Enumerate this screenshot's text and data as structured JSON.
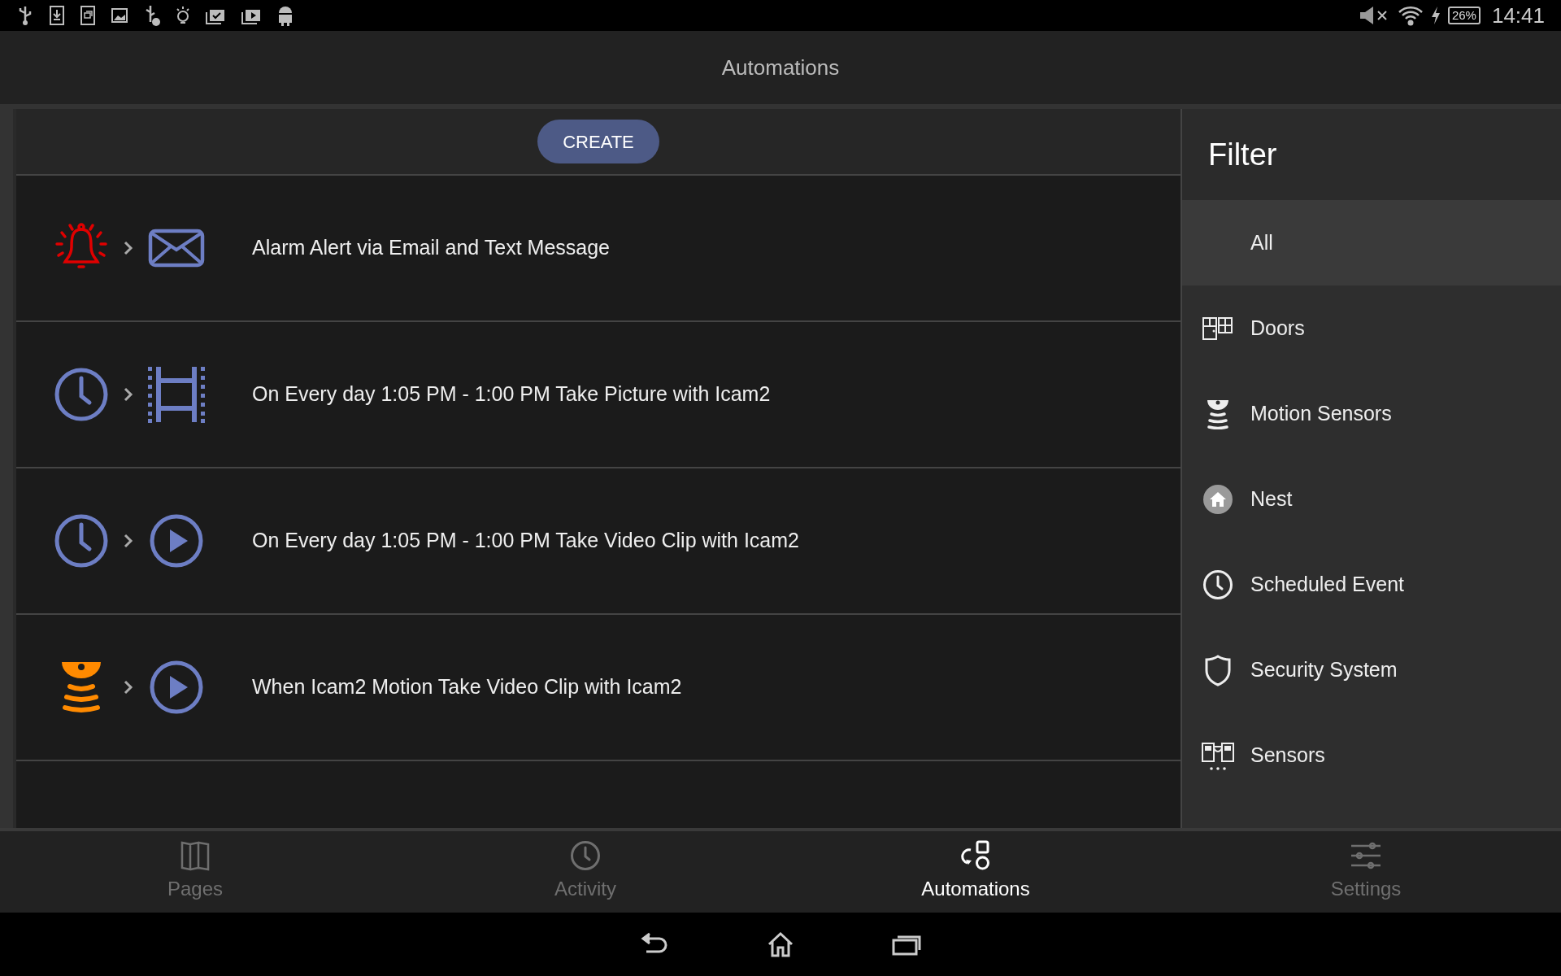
{
  "status_bar": {
    "battery": "26%",
    "time": "14:41"
  },
  "header": {
    "title": "Automations"
  },
  "create_button": "CREATE",
  "automations": [
    {
      "trigger": {
        "kind": "bell"
      },
      "action": {
        "kind": "mail"
      },
      "label": "Alarm Alert via Email and Text Message"
    },
    {
      "trigger": {
        "kind": "clock"
      },
      "action": {
        "kind": "film"
      },
      "label": "On Every day 1:05 PM - 1:00 PM Take Picture with Icam2"
    },
    {
      "trigger": {
        "kind": "clock"
      },
      "action": {
        "kind": "play"
      },
      "label": "On Every day 1:05 PM - 1:00 PM Take Video Clip with Icam2"
    },
    {
      "trigger": {
        "kind": "motion"
      },
      "action": {
        "kind": "play"
      },
      "label": "When Icam2 Motion Take Video Clip with Icam2"
    }
  ],
  "filter": {
    "title": "Filter",
    "items": [
      {
        "kind": "all",
        "label": "All",
        "selected": true
      },
      {
        "kind": "doors",
        "label": "Doors",
        "selected": false
      },
      {
        "kind": "motion",
        "label": "Motion Sensors",
        "selected": false
      },
      {
        "kind": "nest",
        "label": "Nest",
        "selected": false
      },
      {
        "kind": "clock",
        "label": "Scheduled Event",
        "selected": false
      },
      {
        "kind": "shield",
        "label": "Security System",
        "selected": false
      },
      {
        "kind": "sensors",
        "label": "Sensors",
        "selected": false
      }
    ]
  },
  "nav_tabs": [
    {
      "kind": "pages",
      "label": "Pages",
      "selected": false
    },
    {
      "kind": "activity",
      "label": "Activity",
      "selected": false
    },
    {
      "kind": "automations",
      "label": "Automations",
      "selected": true
    },
    {
      "kind": "settings",
      "label": "Settings",
      "selected": false
    }
  ]
}
